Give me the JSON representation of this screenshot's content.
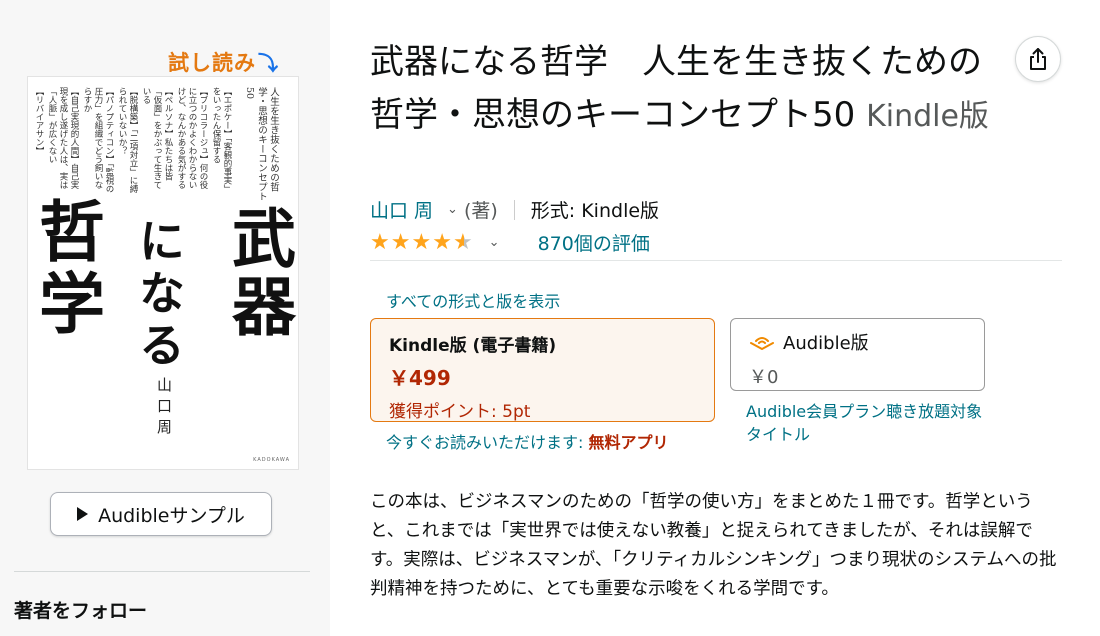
{
  "cover": {
    "try_read_label": "試し読み",
    "try_read_arrow": "⤵",
    "title_word_1": "武器",
    "title_word_2": "になる",
    "title_word_3": "哲学",
    "subtitle_vertical": "人生を生き抜くための哲学・思想のキーコンセプト50",
    "author_vertical": "山口周",
    "chapters": [
      "【エポケー】「客観的事実」をいったん保留する",
      "【ブリコラージュ】何の役に立つのかよくわからないけど、なんかある気がする",
      "【ペルソナ】私たちは皆「仮面」をかぶって生きている",
      "【脱構築】「二項対立」に縛られていないか？",
      "【パノプティコン】「監視の圧力」を組織でどう飼いならすか",
      "【自己実現的人間】自己実現を成し遂げた人は、実は「人脈」が広くない",
      "【リバイアサン】"
    ],
    "publisher": "KADOKAWA"
  },
  "left": {
    "sample_button_label": "Audibleサンプル",
    "follow_heading": "著者をフォロー"
  },
  "product": {
    "title": "武器になる哲学　人生を生き抜くための哲学・思想のキーコンセプト50",
    "format_suffix": "Kindle版",
    "author_name": "山口 周",
    "author_role": "(著)",
    "format_label": "形式: Kindle版",
    "rating_value": 4.5,
    "rating_count": "870個の評価"
  },
  "formats": {
    "show_all_label": "すべての形式と版を表示",
    "kindle": {
      "name": "Kindle版 (電子書籍)",
      "price": "￥499",
      "points": "獲得ポイント: 5pt"
    },
    "audible": {
      "name": "Audible版",
      "price": "￥0",
      "note": "Audible会員プラン聴き放題対象タイトル"
    },
    "free_app_prefix": "今すぐお読みいただけます: ",
    "free_app_link": "無料アプリ"
  },
  "description": "この本は、ビジネスマンのための「哲学の使い方」をまとめた１冊です。哲学というと、これまでは「実世界では使えない教養」と捉えられてきましたが、それは誤解です。実際は、ビジネスマンが、「クリティカルシンキング」つまり現状のシステムへの批判精神を持つために、とても重要な示唆をくれる学問です。",
  "colors": {
    "link": "#007185",
    "price": "#b12704",
    "star": "#ffa41c",
    "selected_border": "#e47911",
    "try_read": "#e47911"
  }
}
